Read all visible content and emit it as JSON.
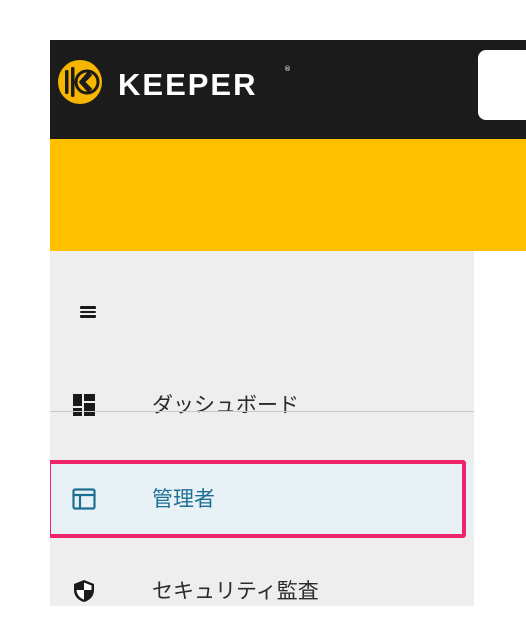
{
  "app": {
    "brand": "KEEPER",
    "brand_reg": "®"
  },
  "colors": {
    "topbar": "#1b1b1b",
    "banner": "#ffc000",
    "sidebar": "#eeeeee",
    "active_text": "#1e6f94",
    "active_bg": "#e8f2f6",
    "highlight": "#f0246b",
    "logo": "#f7b500"
  },
  "sidebar": {
    "menu_icon": "hamburger-menu-icon",
    "items": [
      {
        "label": "ダッシュボード",
        "icon": "dashboard-icon",
        "active": false
      },
      {
        "label": "管理者",
        "icon": "admin-window-icon",
        "active": true
      },
      {
        "label": "セキュリティ監査",
        "icon": "shield-icon",
        "active": false
      }
    ]
  }
}
